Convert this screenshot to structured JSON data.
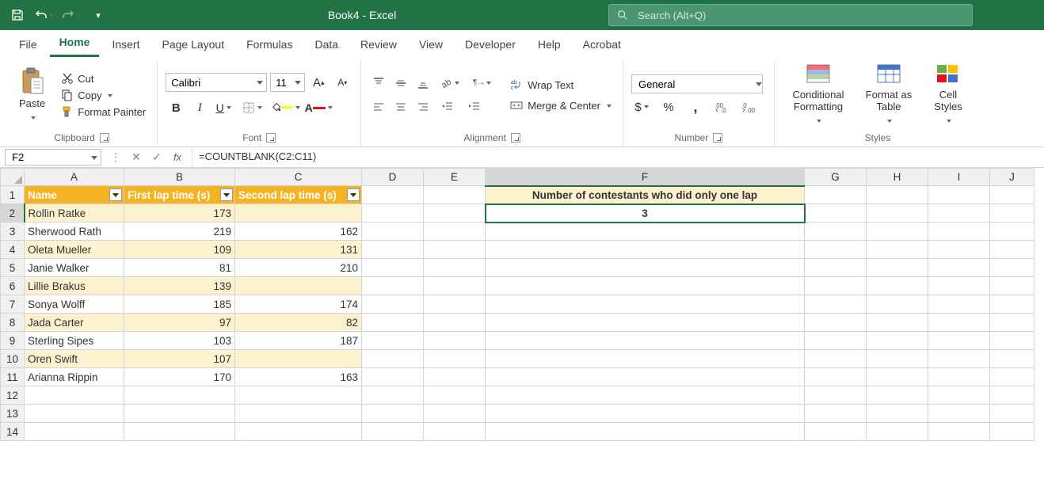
{
  "title": "Book4 - Excel",
  "search_placeholder": "Search (Alt+Q)",
  "tabs": [
    "File",
    "Home",
    "Insert",
    "Page Layout",
    "Formulas",
    "Data",
    "Review",
    "View",
    "Developer",
    "Help",
    "Acrobat"
  ],
  "active_tab": "Home",
  "clipboard": {
    "paste": "Paste",
    "cut": "Cut",
    "copy": "Copy",
    "painter": "Format Painter",
    "label": "Clipboard"
  },
  "font": {
    "name": "Calibri",
    "size": "11",
    "label": "Font"
  },
  "alignment": {
    "wrap": "Wrap Text",
    "merge": "Merge & Center",
    "label": "Alignment"
  },
  "number": {
    "format": "General",
    "label": "Number"
  },
  "styles": {
    "cond": "Conditional Formatting",
    "table": "Format as Table",
    "cell": "Cell Styles",
    "label": "Styles"
  },
  "name_box": "F2",
  "formula": "=COUNTBLANK(C2:C11)",
  "columns": {
    "A": 126,
    "B": 140,
    "C": 160,
    "D": 78,
    "E": 78,
    "F": 403,
    "G": 78,
    "H": 78,
    "I": 78,
    "J": 56
  },
  "headers": {
    "A": "Name",
    "B": "First lap time (s)",
    "C": "Second lap time (s)"
  },
  "rows": [
    {
      "A": "Rollin Ratke",
      "B": 173,
      "C": ""
    },
    {
      "A": "Sherwood Rath",
      "B": 219,
      "C": 162
    },
    {
      "A": "Oleta Mueller",
      "B": 109,
      "C": 131
    },
    {
      "A": "Janie Walker",
      "B": 81,
      "C": 210
    },
    {
      "A": "Lillie Brakus",
      "B": 139,
      "C": ""
    },
    {
      "A": "Sonya Wolff",
      "B": 185,
      "C": 174
    },
    {
      "A": "Jada Carter",
      "B": 97,
      "C": 82
    },
    {
      "A": "Sterling Sipes",
      "B": 103,
      "C": 187
    },
    {
      "A": "Oren Swift",
      "B": 107,
      "C": ""
    },
    {
      "A": "Arianna Rippin",
      "B": 170,
      "C": 163
    }
  ],
  "f1": "Number of contestants who did only one lap",
  "f2": "3"
}
